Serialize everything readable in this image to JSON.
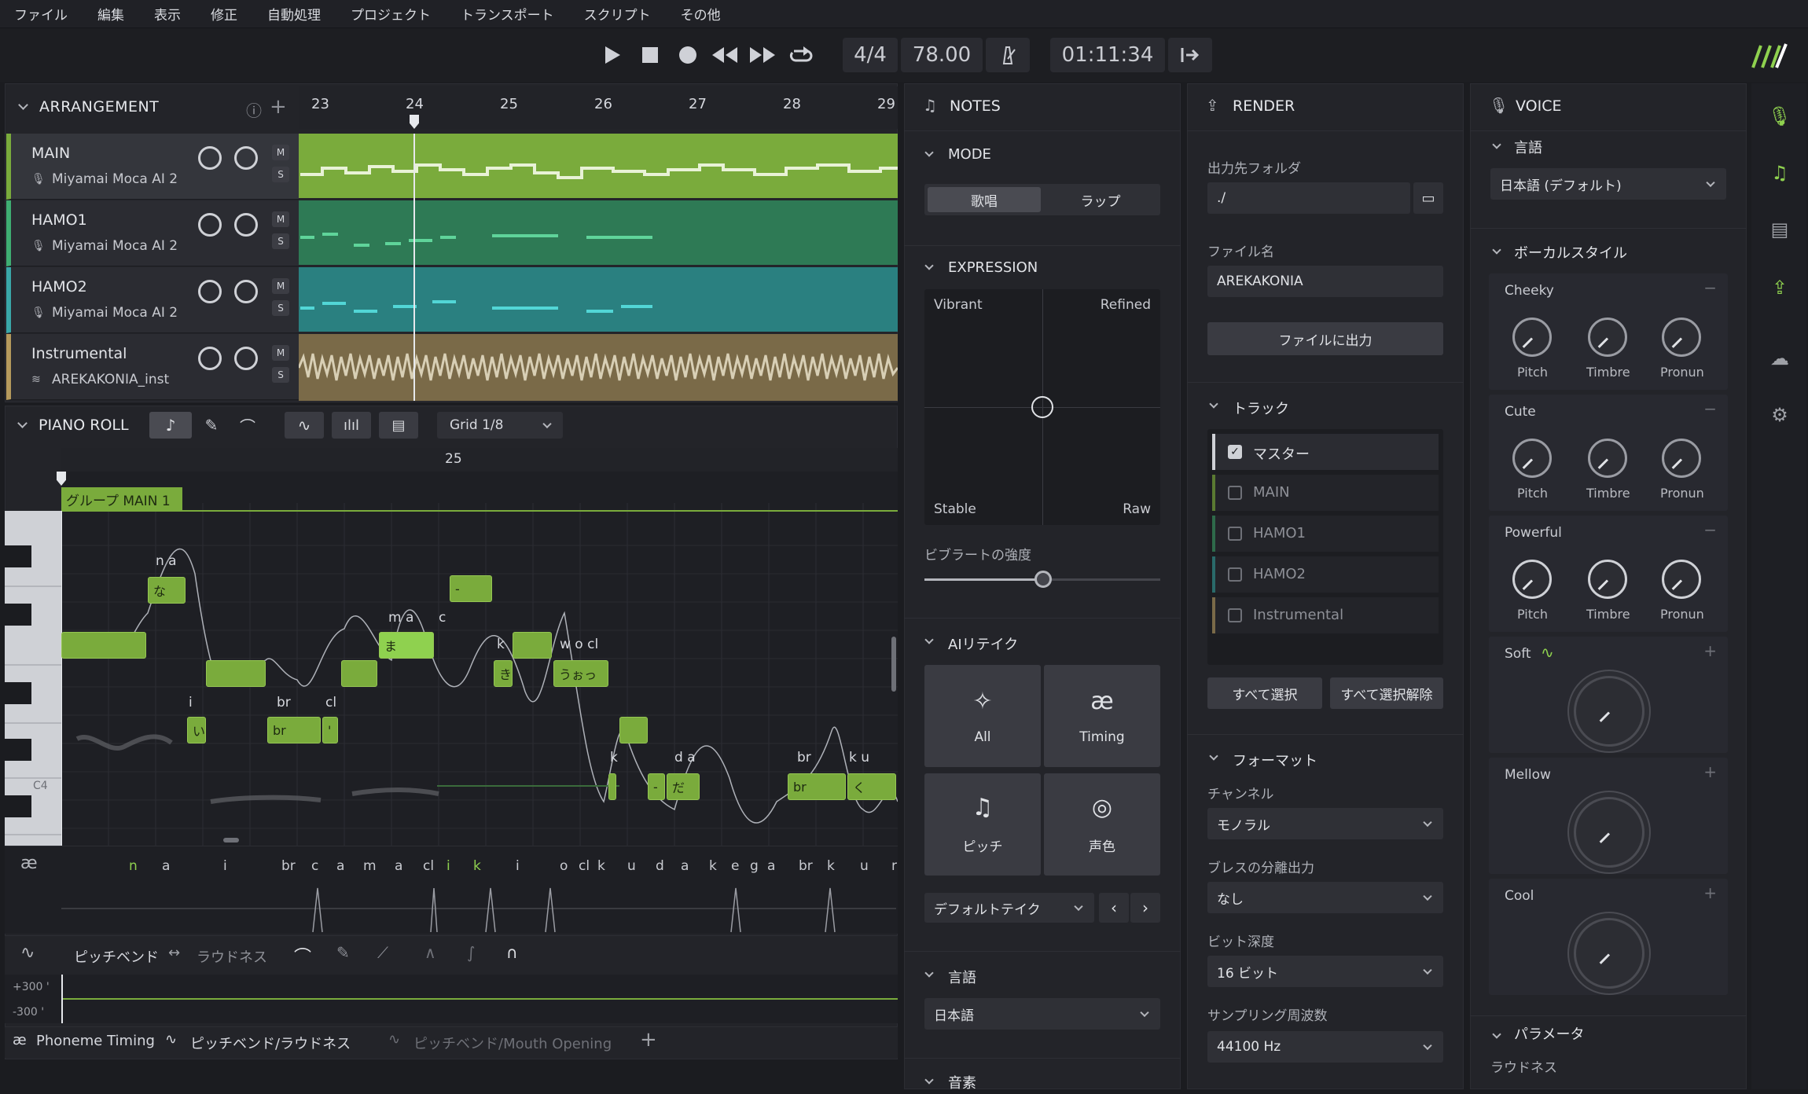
{
  "menu": [
    "ファイル",
    "編集",
    "表示",
    "修正",
    "自動処理",
    "プロジェクト",
    "トランスポート",
    "スクリプト",
    "その他"
  ],
  "transport": {
    "time_sig": "4/4",
    "tempo": "78.00",
    "position": "01:11:34"
  },
  "arrangement": {
    "title": "ARRANGEMENT",
    "ruler": [
      "23",
      "24",
      "25",
      "26",
      "27",
      "28",
      "29"
    ],
    "tracks": [
      {
        "name": "MAIN",
        "voice": "Miyamai Moca AI 2",
        "color": "#7aab3c"
      },
      {
        "name": "HAMO1",
        "voice": "Miyamai Moca AI 2",
        "color": "#2f8a5c"
      },
      {
        "name": "HAMO2",
        "voice": "Miyamai Moca AI 2",
        "color": "#2a8a8a"
      },
      {
        "name": "Instrumental",
        "voice": "AREKAKONIA_inst",
        "color": "#b59a5c"
      }
    ],
    "mute": "M",
    "solo": "S"
  },
  "pianoroll": {
    "title": "PIANO ROLL",
    "grid": "Grid 1/8",
    "ruler": "25",
    "group": "グループ MAIN 1",
    "c4": "C4",
    "lyrics": [
      "n a",
      "な",
      "i",
      "い",
      "br",
      "br",
      "cl",
      "'",
      "m a",
      "ま",
      "c",
      "-",
      "k",
      "き",
      "w o cl",
      "うぉっ",
      "k",
      "d a",
      "-",
      "だ",
      "br",
      "br",
      "k u",
      "く"
    ],
    "phonemes": [
      "n",
      "a",
      "i",
      "br",
      "c",
      "a",
      "m",
      "a",
      "cl",
      "i",
      "k",
      "i",
      "o",
      "cl",
      "k",
      "u",
      "d",
      "a",
      "k",
      "e",
      "g",
      "a",
      "br",
      "k",
      "u",
      "r"
    ],
    "pitchbend_label": "ピッチベンド",
    "loudness_label": "ラウドネス",
    "plus300": "+300 '",
    "minus300": "-300 '",
    "tabs": [
      "Phoneme Timing",
      "ピッチベンド/ラウドネス",
      "ピッチベンド/Mouth Opening"
    ]
  },
  "notes": {
    "title": "NOTES",
    "mode": "MODE",
    "mode_sing": "歌唱",
    "mode_rap": "ラップ",
    "expression": "EXPRESSION",
    "vibrant": "Vibrant",
    "refined": "Refined",
    "stable": "Stable",
    "raw": "Raw",
    "vibrato": "ビブラートの強度",
    "vibrato_value": 0.5,
    "airetake": "AIリテイク",
    "retake_all": "All",
    "retake_timing": "Timing",
    "retake_pitch": "ピッチ",
    "retake_voice": "声色",
    "default_take": "デフォルトテイク",
    "language": "言語",
    "language_value": "日本語",
    "phoneme": "音素"
  },
  "render": {
    "title": "RENDER",
    "out_folder": "出力先フォルダ",
    "out_folder_value": "./",
    "file_name": "ファイル名",
    "file_name_value": "AREKAKONIA",
    "export": "ファイルに出力",
    "track": "トラック",
    "tracks": [
      {
        "name": "マスター",
        "checked": true
      },
      {
        "name": "MAIN",
        "checked": false
      },
      {
        "name": "HAMO1",
        "checked": false
      },
      {
        "name": "HAMO2",
        "checked": false
      },
      {
        "name": "Instrumental",
        "checked": false
      }
    ],
    "select_all": "すべて選択",
    "deselect_all": "すべて選択解除",
    "format": "フォーマット",
    "channel": "チャンネル",
    "channel_value": "モノラル",
    "breath": "ブレスの分離出力",
    "breath_value": "なし",
    "bitdepth": "ビット深度",
    "bitdepth_value": "16 ビット",
    "samplerate": "サンプリング周波数",
    "samplerate_value": "44100 Hz"
  },
  "voice": {
    "title": "VOICE",
    "language": "言語",
    "language_value": "日本語 (デフォルト)",
    "vocalstyle": "ボーカルスタイル",
    "styles": [
      "Cheeky",
      "Cute",
      "Powerful",
      "Soft",
      "Mellow",
      "Cool"
    ],
    "knobs": [
      "Pitch",
      "Timbre",
      "Pronun"
    ],
    "parameter": "パラメータ",
    "loudness": "ラウドネス"
  }
}
